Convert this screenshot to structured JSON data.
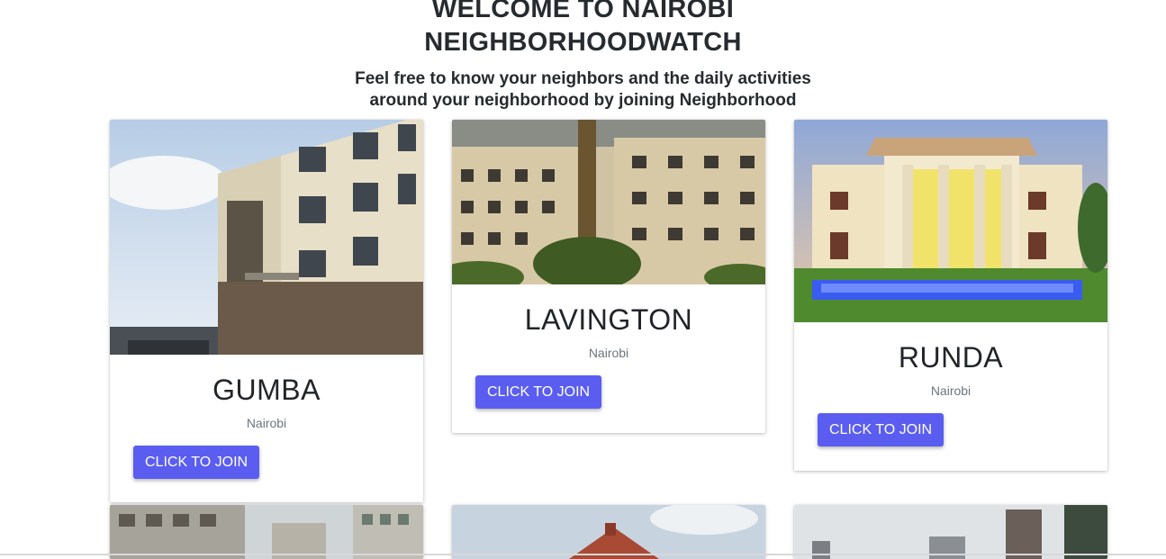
{
  "header": {
    "title_line1": "WELCOME TO NAIROBI",
    "title_line2": "NEIGHBORHOODWATCH",
    "subtitle_line1": "Feel free to know your neighbors and the daily activities",
    "subtitle_line2": "around your neighborhood by joining Neighborhood"
  },
  "neighborhoods": [
    {
      "name": "GUMBA",
      "city": "Nairobi",
      "button": "CLICK TO JOIN"
    },
    {
      "name": "LAVINGTON",
      "city": "Nairobi",
      "button": "CLICK TO JOIN"
    },
    {
      "name": "RUNDA",
      "city": "Nairobi",
      "button": "CLICK TO JOIN"
    }
  ],
  "colors": {
    "button": "#5a5df0",
    "text": "#212529",
    "muted": "#6c757d"
  }
}
